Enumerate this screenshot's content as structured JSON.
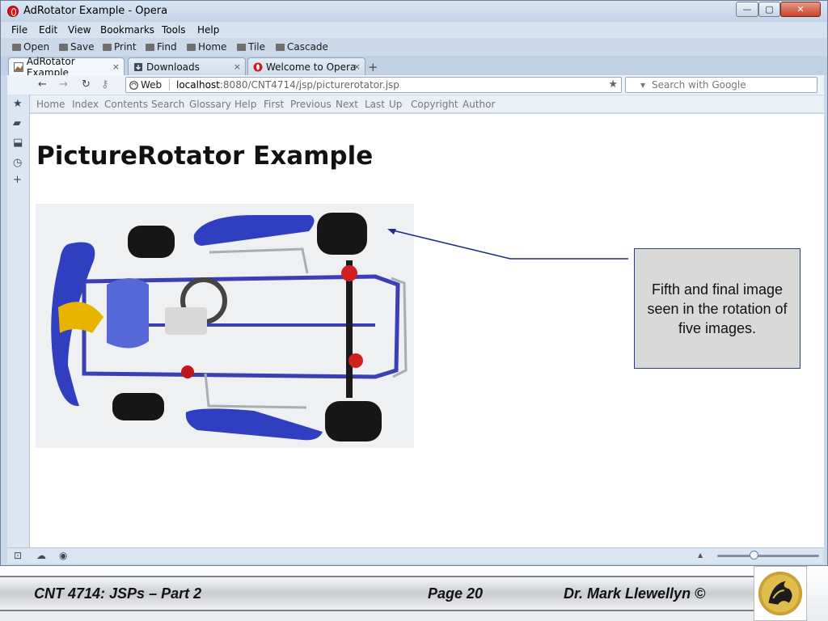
{
  "window": {
    "title": "AdRotator Example - Opera",
    "minimize": "—",
    "maximize": "▢",
    "close": "✕"
  },
  "menu": [
    "File",
    "Edit",
    "View",
    "Bookmarks",
    "Tools",
    "Help"
  ],
  "toolbar": [
    "Open",
    "Save",
    "Print",
    "Find",
    "Home",
    "Tile",
    "Cascade"
  ],
  "tabs": [
    {
      "label": "AdRotator Example",
      "active": true
    },
    {
      "label": "Downloads",
      "active": false
    },
    {
      "label": "Welcome to Opera",
      "active": false
    }
  ],
  "tab_close": "×",
  "new_tab": "+",
  "address": {
    "web_label": "Web",
    "url_host": "localhost",
    "url_rest": ":8080/CNT4714/jsp/picturerotator.jsp",
    "search_placeholder": "Search with Google"
  },
  "nav_links": [
    "Home",
    "Index",
    "Contents",
    "Search",
    "Glossary",
    "Help",
    "First",
    "Previous",
    "Next",
    "Last",
    "Up",
    "Copyright",
    "Author"
  ],
  "page": {
    "heading": "PictureRotator Example"
  },
  "callout": {
    "text": "Fifth and final image seen in the rotation of five images."
  },
  "footer": {
    "left": "CNT 4714: JSPs – Part 2",
    "center": "Page 20",
    "right": "Dr. Mark Llewellyn ©"
  },
  "colors": {
    "callout_border": "#2b3b8f",
    "callout_fill": "#d9d9d9",
    "kart_blue": "#2f3fc0",
    "opera_red": "#d8141b"
  }
}
